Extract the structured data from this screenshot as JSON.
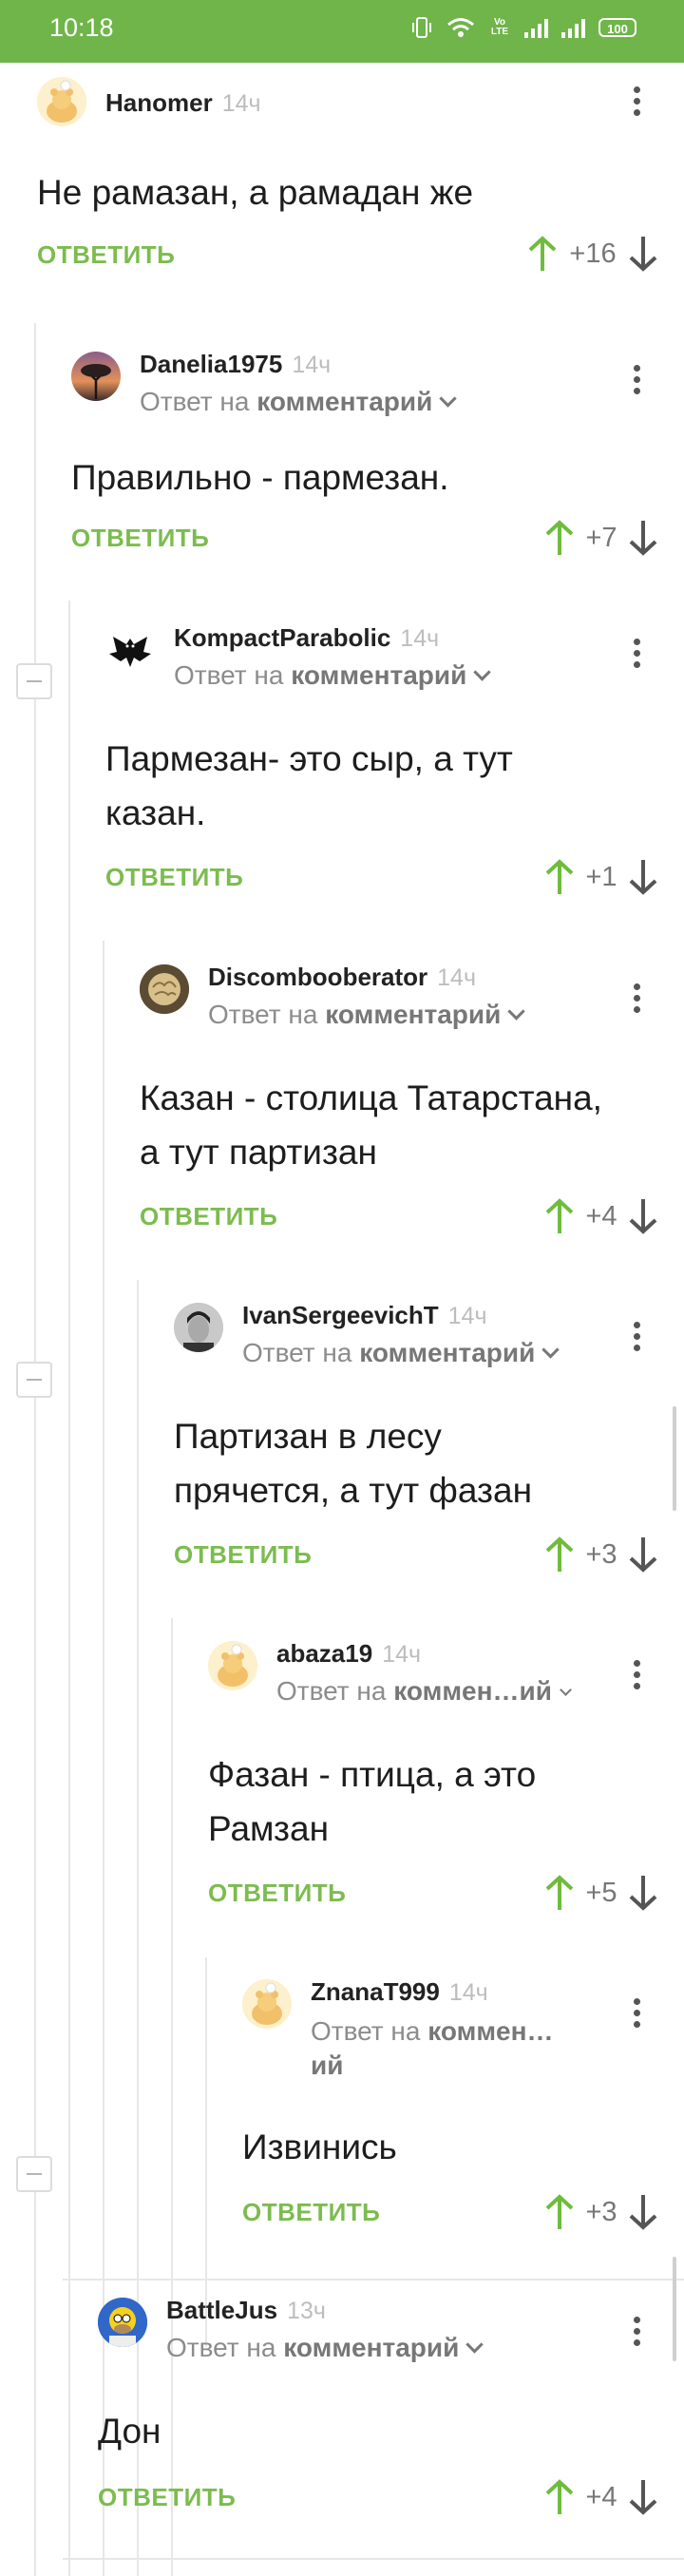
{
  "status_bar": {
    "time": "10:18",
    "network_label": "Vo LTE",
    "battery": "100",
    "bg_color": "#6fb54a"
  },
  "colors": {
    "accent": "#7cbc4f",
    "up_arrow": "#6fbc3c",
    "down_arrow": "#555555"
  },
  "comments": [
    {
      "author": "Hanomer",
      "time": "14ч",
      "reply_to": null,
      "text_lines": [
        "Не рамазан, а рамадан же"
      ],
      "reply_label": "ОТВЕТИТЬ",
      "rating": "+16",
      "avatar_icon": "bear-placeholder-icon"
    },
    {
      "author": "Danelia1975",
      "time": "14ч",
      "reply_to": {
        "prefix": "Ответ на",
        "target": "комментарий"
      },
      "text_lines": [
        "Правильно - пармезан."
      ],
      "reply_label": "ОТВЕТИТЬ",
      "rating": "+7",
      "avatar_icon": "sunset-tree-avatar"
    },
    {
      "author": "KompactParabolic",
      "time": "14ч",
      "reply_to": {
        "prefix": "Ответ на",
        "target": "комментарий"
      },
      "text_lines": [
        "Пармезан- это сыр, а тут",
        "казан."
      ],
      "reply_label": "ОТВЕТИТЬ",
      "rating": "+1",
      "avatar_icon": "bat-avatar"
    },
    {
      "author": "Discombooberator",
      "time": "14ч",
      "reply_to": {
        "prefix": "Ответ на",
        "target": "комментарий"
      },
      "text_lines": [
        "Казан - столица Татарстана,",
        "а тут партизан"
      ],
      "reply_label": "ОТВЕТИТЬ",
      "rating": "+4",
      "avatar_icon": "brain-avatar"
    },
    {
      "author": "IvanSergeevichT",
      "time": "14ч",
      "reply_to": {
        "prefix": "Ответ на",
        "target": "комментарий"
      },
      "text_lines": [
        "Партизан в лесу",
        "прячется, а тут фазан"
      ],
      "reply_label": "ОТВЕТИТЬ",
      "rating": "+3",
      "avatar_icon": "portrait-avatar"
    },
    {
      "author": "abaza19",
      "time": "14ч",
      "reply_to": {
        "prefix": "Ответ на",
        "target": "коммен…ий"
      },
      "text_lines": [
        "Фазан - птица, а это",
        "Рамзан"
      ],
      "reply_label": "ОТВЕТИТЬ",
      "rating": "+5",
      "avatar_icon": "bear-placeholder-icon"
    },
    {
      "author": "ZnanaT999",
      "time": "14ч",
      "reply_to": {
        "prefix": "Ответ на",
        "target": "коммен…",
        "target_line2": "ий"
      },
      "text_lines": [
        "Извинись"
      ],
      "reply_label": "ОТВЕТИТЬ",
      "rating": "+3",
      "avatar_icon": "bear-placeholder-icon"
    },
    {
      "author": "BattleJus",
      "time": "13ч",
      "reply_to": {
        "prefix": "Ответ на",
        "target": "комментарий"
      },
      "text_lines": [
        "Дон"
      ],
      "reply_label": "ОТВЕТИТЬ",
      "rating": "+4",
      "avatar_icon": "homer-avatar"
    }
  ]
}
